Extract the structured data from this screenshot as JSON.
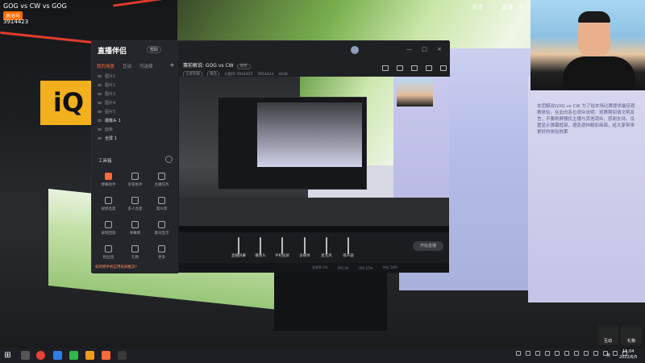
{
  "stream": {
    "title": "GOG vs CW vs GOG",
    "streamer_tag": "房间号",
    "room_id": "3914423",
    "top_right": [
      "关注",
      "直播",
      "×"
    ]
  },
  "app": {
    "logo": "直播伴侣",
    "logo_badge": "帮助",
    "sidebar_tabs": [
      "我的场景",
      "互动",
      "可选择"
    ],
    "add_label": "+",
    "layers": [
      {
        "name": "图片1",
        "on": false
      },
      {
        "name": "图片2",
        "on": false
      },
      {
        "name": "图片3",
        "on": false
      },
      {
        "name": "图片4",
        "on": false
      },
      {
        "name": "图片5",
        "on": false
      },
      {
        "name": "摄像头 1",
        "on": true
      },
      {
        "name": "面板",
        "on": false
      },
      {
        "name": "全屏 1",
        "on": true
      }
    ],
    "toolbox_title": "工具箱",
    "tools": [
      "弹幕助手",
      "房管助手",
      "主播任务",
      "视频连麦",
      "多人连麦",
      "观众席",
      "录制回放",
      "弹幕库",
      "歌词显示",
      "粉丝团",
      "礼物",
      "更多"
    ],
    "tip": "如何把手机应用投屏推流?",
    "room_title": "赛前解说: GOG vs CW",
    "room_title_edit": "修改",
    "room_meta": [
      "王者荣耀",
      "精品",
      "斗鱼ID 3914423",
      "3914423",
      "4436"
    ],
    "window_controls": "— □ ×",
    "bottom_items": [
      "直播屏幕",
      "摄像头",
      "手机投屏",
      "多媒体",
      "麦克风",
      "扬声器"
    ],
    "start_label": "开始直播",
    "status": [
      "丢帧率 0%",
      "FPS 30",
      "CPU 15%",
      "内存 18%"
    ]
  },
  "overlay_text": "本团解说GOG vs CW 为了给本场比赛提供最佳观赛体验，在此向各位观众说明：观赛期间请文明发言，不要刷屏骚扰主播与其他观众，感谢支持。设置显示弹幕框架，避免遮挡精彩画面，给大家带来更好的体验效果",
  "buttons": {
    "interact": "互动",
    "gift": "礼物"
  },
  "taskbar": {
    "tray_text": "英",
    "time": "15:04",
    "date": "2022/6/5"
  },
  "colors": {
    "accent": "#ff6a3d",
    "app_bg": "#1b1c20",
    "sidebar_bg": "#25262b"
  }
}
